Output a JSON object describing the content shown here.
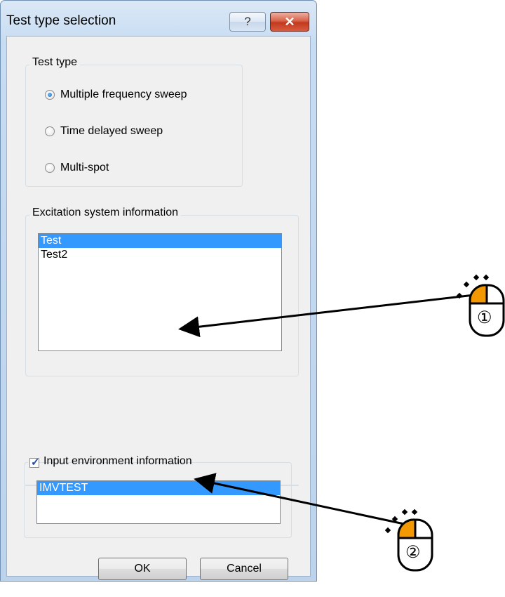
{
  "window": {
    "title": "Test type selection",
    "help_icon": "?",
    "close_icon": "✕"
  },
  "test_type": {
    "legend": "Test type",
    "options": [
      {
        "label": "Multiple frequency sweep",
        "selected": true
      },
      {
        "label": "Time delayed sweep",
        "selected": false
      },
      {
        "label": "Multi-spot",
        "selected": false
      }
    ]
  },
  "excitation": {
    "legend": "Excitation system information",
    "items": [
      {
        "label": "Test",
        "selected": true
      },
      {
        "label": "Test2",
        "selected": false
      }
    ]
  },
  "input_env": {
    "legend": "Input environment information",
    "checked": true,
    "items": [
      {
        "label": "IMVTEST",
        "selected": true
      }
    ]
  },
  "buttons": {
    "ok": "OK",
    "cancel": "Cancel"
  },
  "annotations": {
    "step1": "①",
    "step2": "②",
    "accent_color": "#f39800"
  }
}
